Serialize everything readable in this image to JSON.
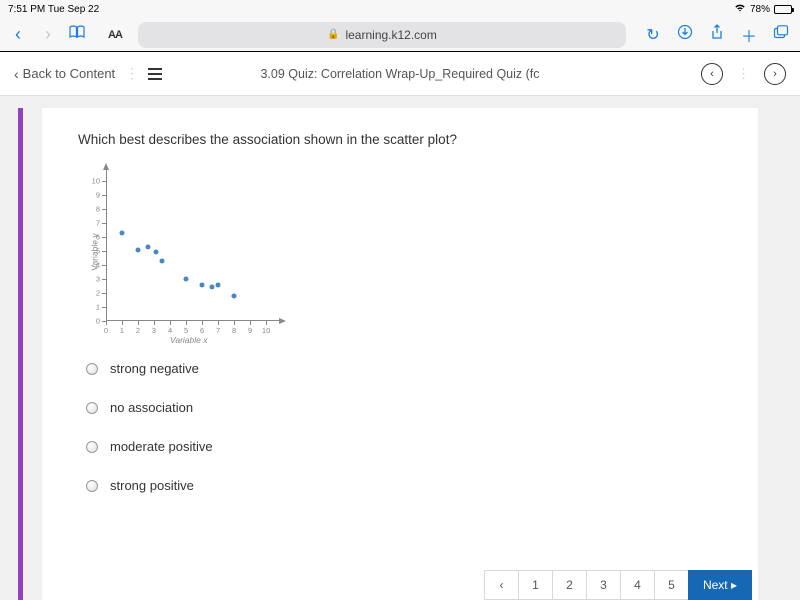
{
  "status": {
    "time_date": "7:51 PM   Tue Sep 22",
    "battery_pct": "78%"
  },
  "browser": {
    "aa": "AA",
    "url": "learning.k12.com"
  },
  "header": {
    "back_label": "Back to Content",
    "title": "3.09 Quiz: Correlation Wrap-Up_Required Quiz (fc"
  },
  "question": "Which best describes the association shown in the scatter plot?",
  "chart_data": {
    "type": "scatter",
    "xlabel": "Variable x",
    "ylabel": "Variable y",
    "xlim": [
      0,
      10
    ],
    "ylim": [
      0,
      10
    ],
    "x_ticks": [
      0,
      1,
      2,
      3,
      4,
      5,
      6,
      7,
      8,
      9,
      10
    ],
    "y_ticks": [
      0,
      1,
      2,
      3,
      4,
      5,
      6,
      7,
      8,
      9,
      10
    ],
    "points": [
      {
        "x": 1,
        "y": 6.3
      },
      {
        "x": 2,
        "y": 5.1
      },
      {
        "x": 2.6,
        "y": 5.3
      },
      {
        "x": 3.1,
        "y": 4.9
      },
      {
        "x": 3.5,
        "y": 4.3
      },
      {
        "x": 5,
        "y": 3
      },
      {
        "x": 6,
        "y": 2.6
      },
      {
        "x": 6.6,
        "y": 2.4
      },
      {
        "x": 7,
        "y": 2.6
      },
      {
        "x": 8,
        "y": 1.8
      }
    ]
  },
  "options": [
    {
      "label": "strong negative"
    },
    {
      "label": "no association"
    },
    {
      "label": "moderate positive"
    },
    {
      "label": "strong positive"
    }
  ],
  "pager": {
    "prev": "‹",
    "pages": [
      "1",
      "2",
      "3",
      "4",
      "5"
    ],
    "next": "Next ▸"
  }
}
